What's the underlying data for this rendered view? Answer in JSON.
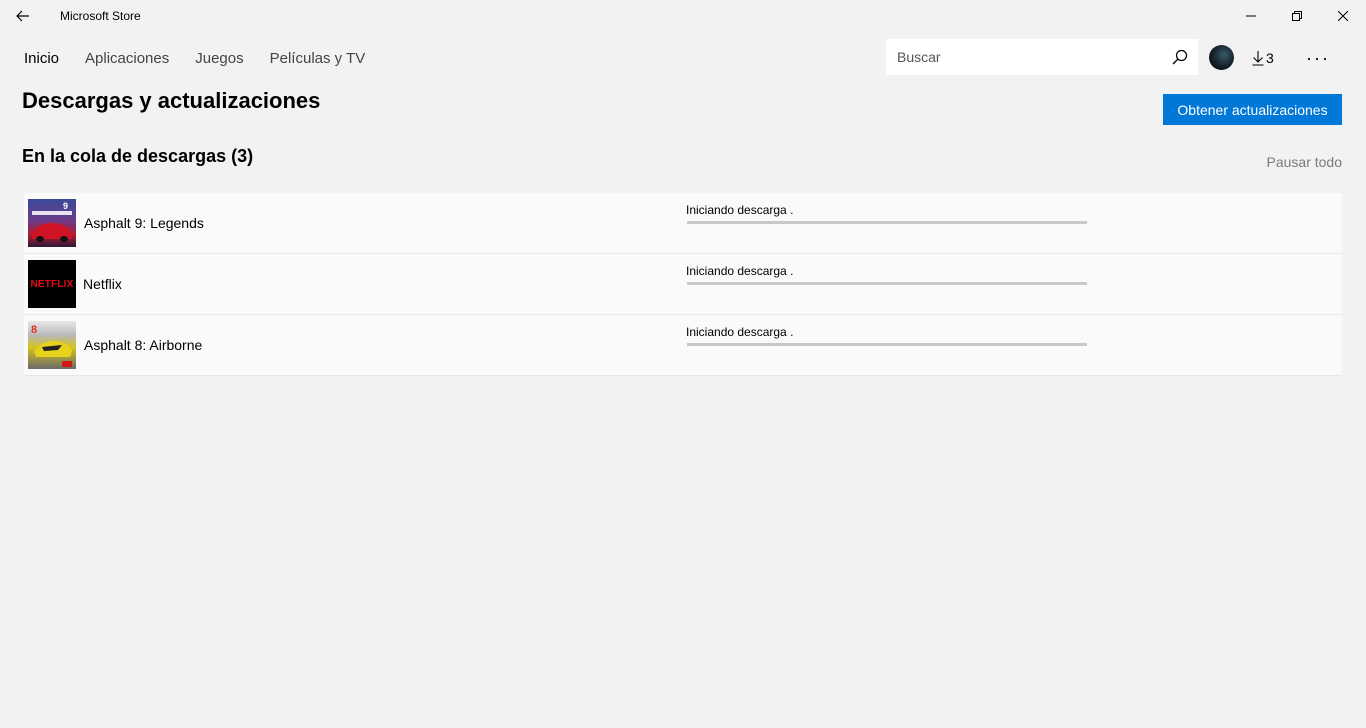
{
  "window": {
    "title": "Microsoft Store"
  },
  "nav": {
    "items": [
      "Inicio",
      "Aplicaciones",
      "Juegos",
      "Películas y TV"
    ],
    "active": "Inicio"
  },
  "search": {
    "placeholder": "Buscar",
    "value": ""
  },
  "header": {
    "downloads_count": "3"
  },
  "page": {
    "title": "Descargas y actualizaciones",
    "get_updates_label": "Obtener actualizaciones",
    "section_title": "En la cola de descargas (3)",
    "pause_all_label": "Pausar todo"
  },
  "queue": [
    {
      "name": "Asphalt 9: Legends",
      "status": "Iniciando descarga .",
      "progress": 0,
      "icon": "asphalt9-icon",
      "badge": "9"
    },
    {
      "name": "Netflix",
      "status": "Iniciando descarga .",
      "progress": 0,
      "icon": "netflix-icon",
      "badge": "NETFLIX"
    },
    {
      "name": "Asphalt 8: Airborne",
      "status": "Iniciando descarga .",
      "progress": 0,
      "icon": "asphalt8-icon",
      "badge": "8"
    }
  ],
  "colors": {
    "accent": "#0078d7",
    "background": "#f2f2f2",
    "progress_track": "#c8c8c8",
    "netflix_red": "#e50914"
  }
}
